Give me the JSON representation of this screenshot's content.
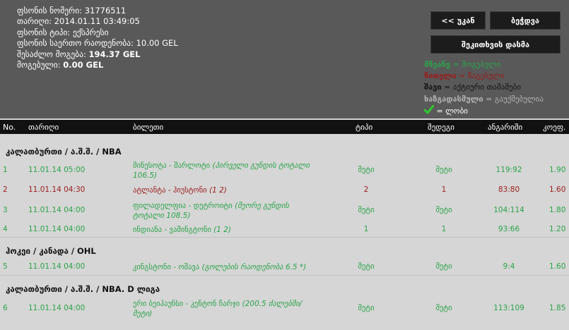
{
  "info": {
    "ticket_number_label": "ფსონის ნომერი:",
    "ticket_number": "31776511",
    "date_label": "თარიღი:",
    "date": "2014.01.11 03:49:05",
    "type_label": "ფსონის ტიპი:",
    "type": "ექსპრესი",
    "amount_label": "ფსონის საერთო რაოდენობა:",
    "amount": "10.00 GEL",
    "possible_win_label": "შესაძლო მოგება:",
    "possible_win": "194.37 GEL",
    "won_label": "მოგებული:",
    "won": "0.00 GEL"
  },
  "buttons": {
    "back": "<< უკან",
    "print": "ბეჭდვა",
    "save_check": "შეკითხვის დასმა"
  },
  "legend": {
    "green_key": "მწვანე",
    "green_text": "= მოგებული",
    "red_key": "წითელი",
    "red_text": "= წაგებული",
    "black_key": "შავი",
    "black_text": "= აქტიური თამაშები",
    "gray_key": "ხაზგადასმული",
    "gray_text": "= გაუქმებულია",
    "check_text": "= ლობი"
  },
  "colors": {
    "green": "#2aa34a",
    "red": "#9b1b1b",
    "black": "#111111",
    "gray": "#b3b3b3",
    "check": "#2ecc2e"
  },
  "table": {
    "headers": [
      "No.",
      "თარიღი",
      "ბილეთი",
      "ტიპი",
      "შედეგი",
      "ანგარიში",
      "კოეფ."
    ],
    "groups": [
      {
        "title": "კალათბურთი / ა.შ.შ. / NBA",
        "rows": [
          {
            "no": "1",
            "date": "11.01.14 05:00",
            "bet": "მინესოტა - შარლოტი",
            "bet_extra": "(პირველი გუნდის ტოტალი",
            "bet_extra2": "106.5)",
            "type": "მეტი",
            "result": "მეტი",
            "score": "119:92",
            "coef": "1.90",
            "status": "green"
          },
          {
            "no": "2",
            "date": "11.01.14 04:30",
            "bet": "ატლანტა - ჰიუსტონი",
            "bet_extra": "(1 2)",
            "bet_extra2": "",
            "type": "2",
            "result": "1",
            "score": "83:80",
            "coef": "1.60",
            "status": "red"
          },
          {
            "no": "3",
            "date": "11.01.14 04:00",
            "bet": "ფილადელფია - დეტროიტი",
            "bet_extra": "(მეორე გუნდის",
            "bet_extra2": "ტოტალი 108.5)",
            "type": "მეტი",
            "result": "მეტი",
            "score": "104:114",
            "coef": "1.80",
            "status": "green"
          },
          {
            "no": "4",
            "date": "11.01.14 04:00",
            "bet": "ინდიანა - ვაშინგტონი",
            "bet_extra": "(1 2)",
            "bet_extra2": "",
            "type": "1",
            "result": "1",
            "score": "93:66",
            "coef": "1.20",
            "status": "green"
          }
        ]
      },
      {
        "title": "ჰოკეი / კანადა / OHL",
        "rows": [
          {
            "no": "5",
            "date": "11.01.14 04:00",
            "bet": "კინგსტონი - ოშავა",
            "bet_extra": "(გოლების რაოდენობა 6.5 *)",
            "bet_extra2": "",
            "type": "მეტი",
            "result": "მეტი",
            "score": "9:4",
            "coef": "1.60",
            "status": "green"
          }
        ]
      },
      {
        "title": "კალათბურთი / ა.შ.შ. / NBA. D ლიგა",
        "rows": [
          {
            "no": "6",
            "date": "11.01.14 04:00",
            "bet": "ერი ბეიჰაუნსი - კენტონ ჩარჯი",
            "bet_extra": "(200.5 ძალებში/",
            "bet_extra2": "მეტი)",
            "type": "მეტი",
            "result": "მეტი",
            "score": "113:109",
            "coef": "1.85",
            "status": "green"
          }
        ]
      }
    ]
  }
}
